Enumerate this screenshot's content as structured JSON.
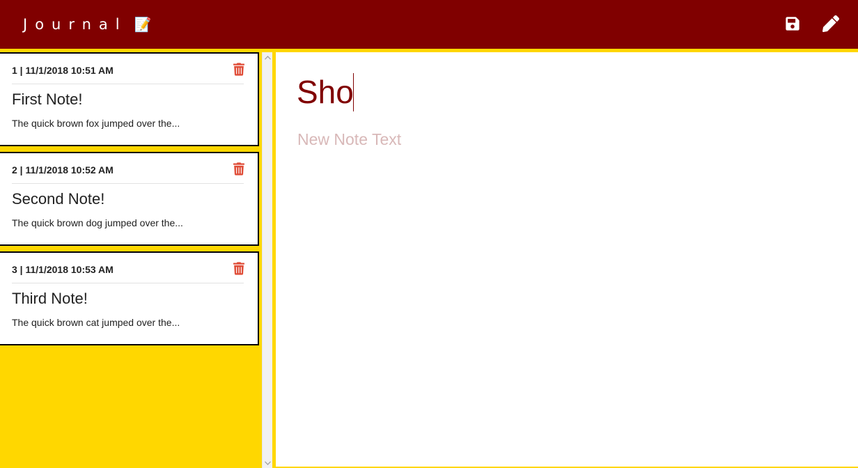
{
  "header": {
    "brand": "Journal",
    "brand_emoji": "📝",
    "save_icon": "floppy-disk-icon",
    "edit_icon": "pencil-icon"
  },
  "notes": [
    {
      "meta": "1 | 11/1/2018 10:51 AM",
      "title": "First Note!",
      "snippet": "The quick brown fox jumped over the..."
    },
    {
      "meta": "2 | 11/1/2018 10:52 AM",
      "title": "Second Note!",
      "snippet": "The quick brown dog jumped over the..."
    },
    {
      "meta": "3 | 11/1/2018 10:53 AM",
      "title": "Third Note!",
      "snippet": "The quick brown cat jumped over the..."
    }
  ],
  "editor": {
    "title_value": "Sho",
    "text_value": "",
    "text_placeholder": "New Note Text"
  },
  "colors": {
    "navbar": "#800000",
    "sidebar": "#FFD700",
    "delete_icon": "#E04E39",
    "title_text": "#800000"
  }
}
